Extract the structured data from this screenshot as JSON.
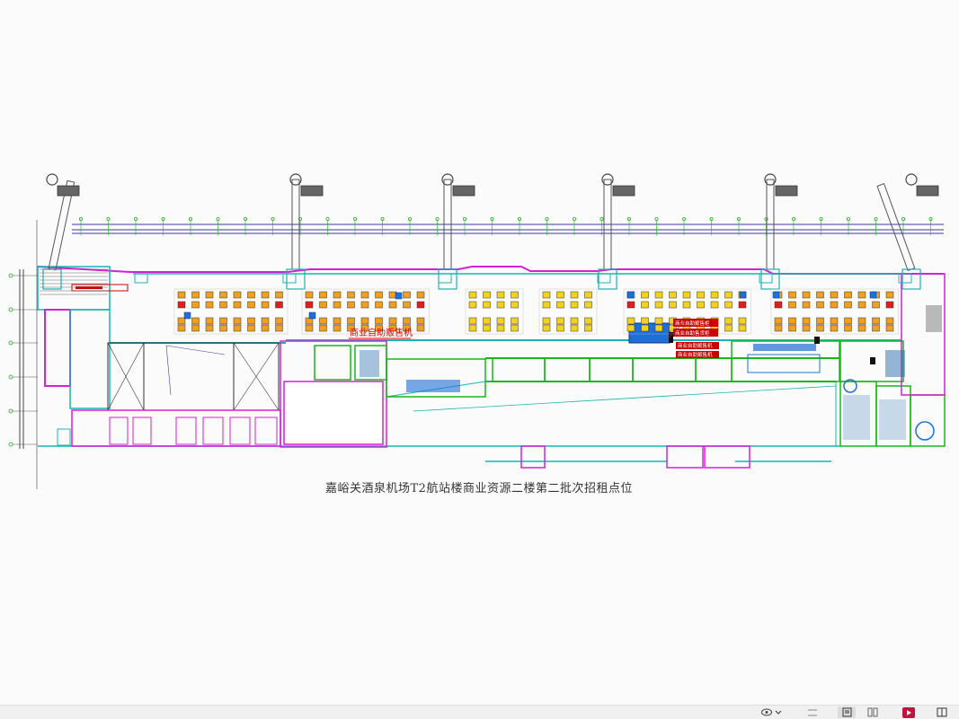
{
  "document": {
    "caption": "嘉峪关酒泉机场T2航站楼商业资源二楼第二批次招租点位"
  },
  "plan_labels": {
    "vending_zone": "商业自助贩售机",
    "callout_1": "商业自助贩售柜",
    "callout_2": "商业自助售货柜",
    "callout_3": "商业自助贩售机",
    "callout_4": "商业自助贩售机"
  },
  "colors": {
    "wall_cyan": "#19b4b4",
    "wall_magenta": "#d61fd6",
    "wall_green": "#17b817",
    "wall_blue": "#2a2ad6",
    "seat_orange": "#f0a020",
    "seat_red": "#e02020",
    "seat_yellow": "#f2d21e",
    "kiosk_blue": "#1e6fd6",
    "bar_red": "#cc0000"
  },
  "bottom_bar": {
    "icons": [
      "eye-icon",
      "chevron-down-icon",
      "layout-icon",
      "read-mode-icon",
      "two-page-icon",
      "video-icon",
      "book-icon"
    ]
  }
}
